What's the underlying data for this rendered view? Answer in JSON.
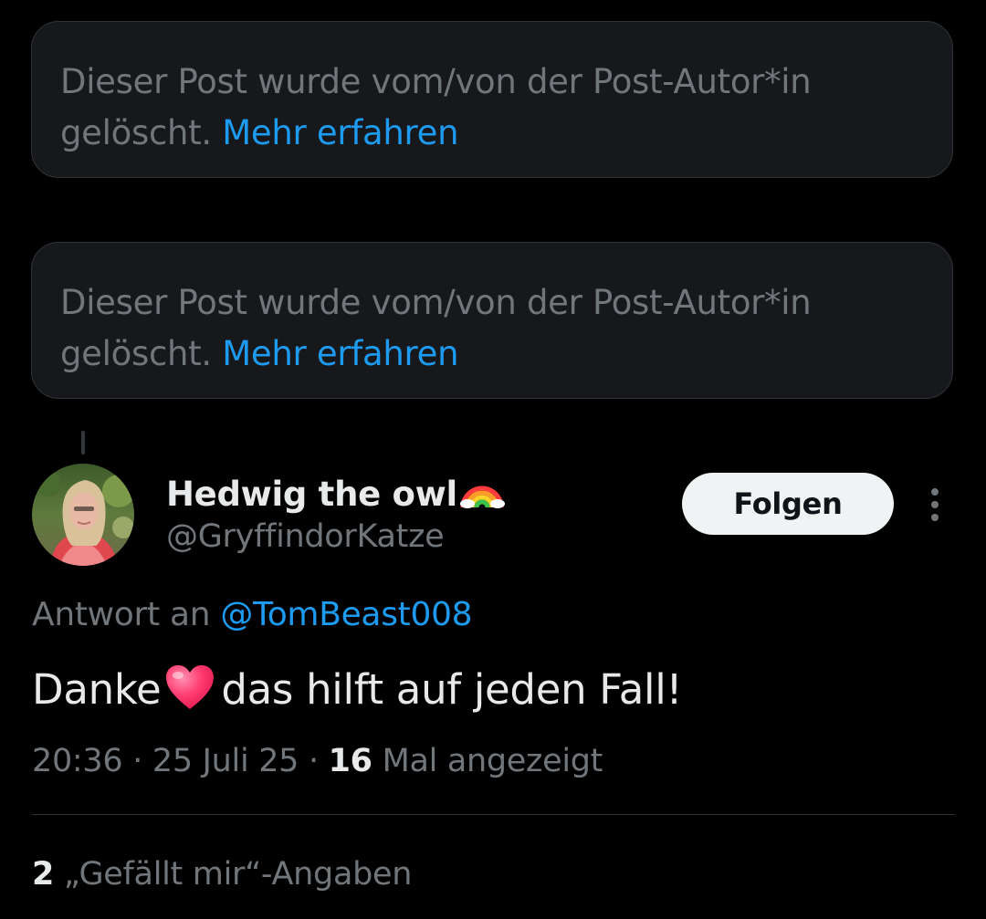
{
  "deleted_posts": [
    {
      "text": "Dieser Post wurde vom/von der Post-Autor*in gelöscht.",
      "link": "Mehr erfahren"
    },
    {
      "text": "Dieser Post wurde vom/von der Post-Autor*in gelöscht.",
      "link": "Mehr erfahren"
    }
  ],
  "author": {
    "display_name": "Hedwig the owl",
    "name_emoji": "rainbow-icon",
    "handle": "@GryffindorKatze",
    "follow_label": "Folgen",
    "more_icon": "more-vertical-icon"
  },
  "reply": {
    "prefix": "Antwort an",
    "mention": "@TomBeast008"
  },
  "post": {
    "text_before": "Danke",
    "emoji": "heart-icon",
    "text_after": "das hilft auf jeden Fall!"
  },
  "meta": {
    "time": "20:36",
    "sep1": "·",
    "date": "25 Juli 25",
    "sep2": "·",
    "views_count": "16",
    "views_label": "Mal angezeigt"
  },
  "likes": {
    "count": "2",
    "label": "„Gefällt mir“-Angaben"
  },
  "colors": {
    "background": "#000000",
    "card": "#16181c",
    "secondary_text": "#71767b",
    "primary_text": "#e7e9ea",
    "link": "#1d9bf0",
    "button_bg": "#eff3f4"
  }
}
